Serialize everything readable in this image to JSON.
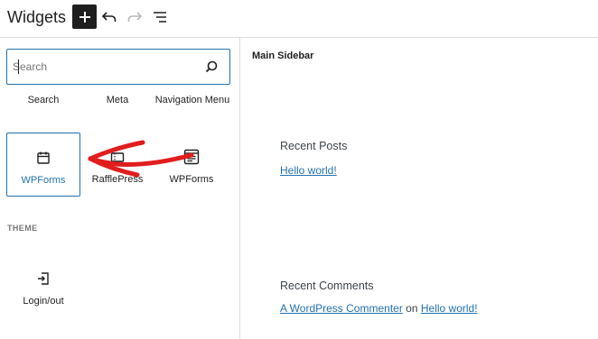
{
  "header": {
    "title": "Widgets"
  },
  "inserter": {
    "search_placeholder": "Search",
    "blocks_row1": [
      "Search",
      "Meta",
      "Navigation Menu"
    ],
    "blocks_row2": [
      {
        "label": "WPForms",
        "icon": "calendar-icon",
        "selected": true
      },
      {
        "label": "RafflePress",
        "icon": "raffle-icon",
        "selected": false
      },
      {
        "label": "WPForms",
        "icon": "form-icon",
        "selected": false
      }
    ],
    "theme_heading": "THEME",
    "theme_blocks": [
      {
        "label": "Login/out",
        "icon": "login-icon"
      }
    ]
  },
  "canvas": {
    "sidebar_title": "Main Sidebar",
    "recent_posts": {
      "heading": "Recent Posts",
      "post": "Hello world!"
    },
    "recent_comments": {
      "heading": "Recent Comments",
      "author": "A WordPress Commenter",
      "connector": "on",
      "post": "Hello world!"
    }
  },
  "colors": {
    "accent": "#2271b1",
    "annotation_arrow": "#e11d1d"
  }
}
